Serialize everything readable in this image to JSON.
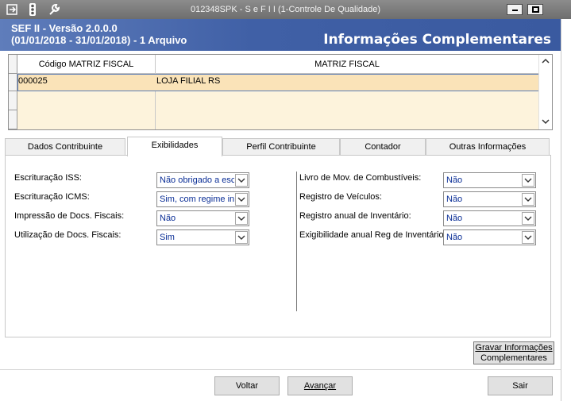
{
  "window": {
    "title": "012348SPK - S e F  I I (1-Controle De Qualidade)"
  },
  "header": {
    "version": "SEF II - Versão 2.0.0.0",
    "period": "(01/01/2018 - 31/01/2018) - 1 Arquivo",
    "section_title": "Informações Complementares"
  },
  "grid": {
    "columns": [
      "Código MATRIZ FISCAL",
      "MATRIZ FISCAL"
    ],
    "rows": [
      {
        "code": "000025",
        "name": "LOJA FILIAL RS"
      }
    ]
  },
  "tabs": [
    {
      "label": "Dados Contribuinte"
    },
    {
      "label": "Exibilidades"
    },
    {
      "label": "Perfil Contribuinte"
    },
    {
      "label": "Contador"
    },
    {
      "label": "Outras Informações"
    }
  ],
  "left_fields": [
    {
      "label": "Escrituração ISS:",
      "value": "Não obrigado a escrituração"
    },
    {
      "label": "Escrituração ICMS:",
      "value": "Sim, com regime integral"
    },
    {
      "label": "Impressão de Docs. Fiscais:",
      "value": "Não"
    },
    {
      "label": "Utilização de Docs. Fiscais:",
      "value": "Sim"
    }
  ],
  "right_fields": [
    {
      "label": "Livro de Mov. de Combustíveis:",
      "value": "Não"
    },
    {
      "label": "Registro de Veículos:",
      "value": "Não"
    },
    {
      "label": "Registro anual de Inventário:",
      "value": "Não"
    },
    {
      "label": "Exigibilidade anual Reg de Inventário:",
      "value": "Não"
    }
  ],
  "buttons": {
    "save_line1": "Gravar Informações",
    "save_line2": "Complementares",
    "back": "Voltar",
    "next": "Avançar",
    "exit": "Sair"
  },
  "colors": {
    "header_blue": "#4060a6",
    "selected_row": "#fae3b8",
    "combo_text": "#0a2e96"
  }
}
